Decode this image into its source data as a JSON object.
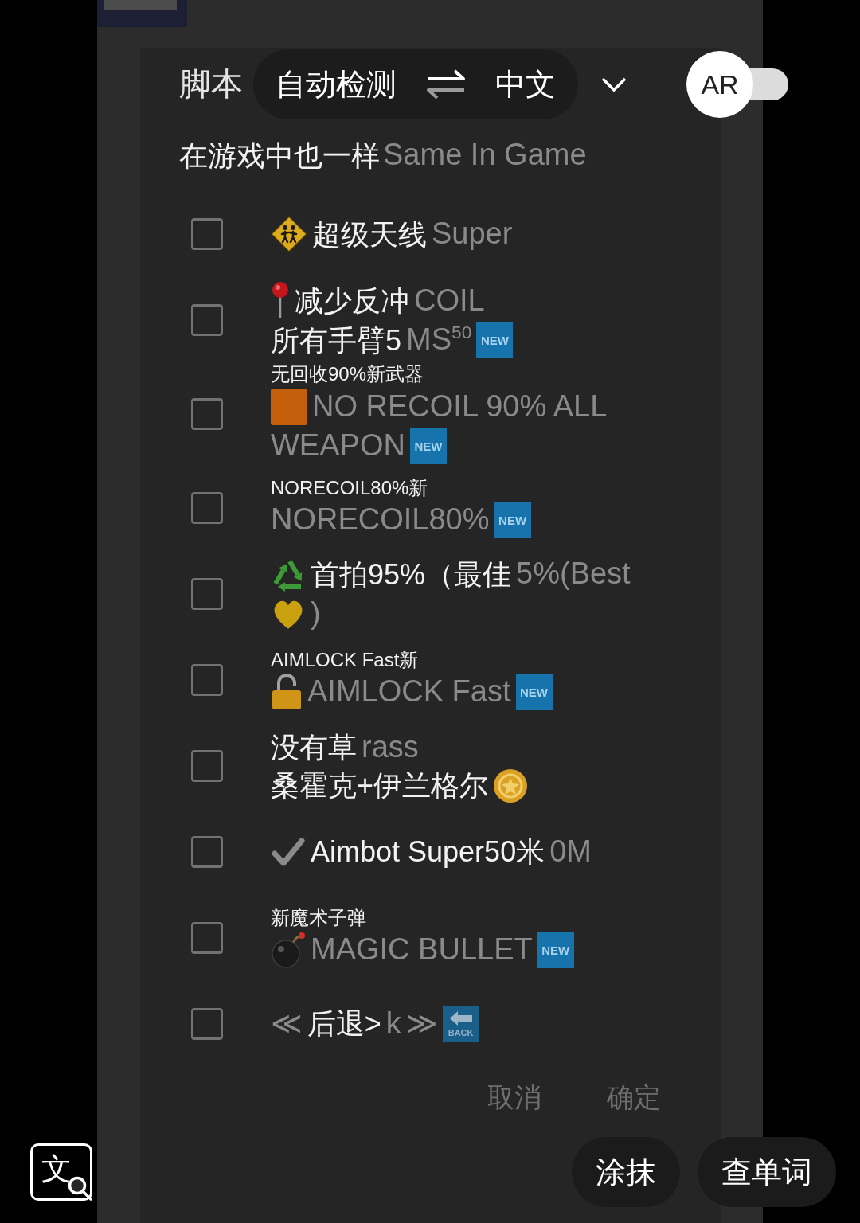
{
  "header": {
    "title": "脚本",
    "source_language": "自动检测",
    "target_language": "中文",
    "ar_switch": {
      "label": "AR",
      "on": false
    }
  },
  "subtitle": [
    {
      "kind": "translation",
      "text": "在游戏中也一样"
    },
    {
      "kind": "original",
      "text": "Same In Game"
    }
  ],
  "options": [
    {
      "checked": false,
      "lines": [
        [
          {
            "kind": "sign"
          },
          {
            "kind": "translation",
            "text": "超级天线"
          },
          {
            "kind": "original",
            "text": "Super"
          }
        ]
      ]
    },
    {
      "checked": false,
      "lines": [
        [
          {
            "kind": "pin"
          },
          {
            "kind": "translation",
            "text": "减少反冲"
          },
          {
            "kind": "original",
            "text": "COIL"
          }
        ],
        [
          {
            "kind": "translation",
            "text": "所有手臂5"
          },
          {
            "kind": "original",
            "text": "MS$^{50}$"
          },
          {
            "kind": "badge",
            "text": "NEW"
          }
        ]
      ]
    },
    {
      "checked": false,
      "lines": [
        [
          {
            "kind": "caption",
            "text": "无回收90%新武器"
          }
        ],
        [
          {
            "kind": "tile"
          },
          {
            "kind": "original",
            "text": "NO RECOIL 90% ALL"
          }
        ],
        [
          {
            "kind": "original",
            "text": "WEAPON"
          },
          {
            "kind": "badge",
            "text": "NEW"
          }
        ]
      ]
    },
    {
      "checked": false,
      "lines": [
        [
          {
            "kind": "caption",
            "text": "NORECOIL80%新"
          }
        ],
        [
          {
            "kind": "original",
            "text": "NORECOIL80%"
          },
          {
            "kind": "badge",
            "text": "NEW"
          }
        ]
      ]
    },
    {
      "checked": false,
      "lines": [
        [
          {
            "kind": "recycle"
          },
          {
            "kind": "translation",
            "text": "首拍95%（最佳"
          },
          {
            "kind": "original",
            "text": "5%(Best"
          }
        ],
        [
          {
            "kind": "heart"
          },
          {
            "kind": "original",
            "text": ")"
          }
        ]
      ]
    },
    {
      "checked": false,
      "lines": [
        [
          {
            "kind": "caption",
            "text": "AIMLOCK Fast新"
          }
        ],
        [
          {
            "kind": "padlock"
          },
          {
            "kind": "original",
            "text": "AIMLOCK Fast"
          },
          {
            "kind": "badge",
            "text": "NEW"
          }
        ]
      ]
    },
    {
      "checked": false,
      "lines": [
        [
          {
            "kind": "translation",
            "text": "没有草"
          },
          {
            "kind": "original",
            "text": "rass"
          }
        ],
        [
          {
            "kind": "translation",
            "text": "桑霍克+伊兰格尔"
          },
          {
            "kind": "coin"
          }
        ]
      ]
    },
    {
      "checked": false,
      "lines": [
        [
          {
            "kind": "check"
          },
          {
            "kind": "translation",
            "text": "Aimbot Super50米"
          },
          {
            "kind": "original",
            "text": "0M"
          }
        ]
      ]
    },
    {
      "checked": false,
      "lines": [
        [
          {
            "kind": "caption",
            "text": "新魔术子弹"
          }
        ],
        [
          {
            "kind": "bomb"
          },
          {
            "kind": "original",
            "text": "MAGIC BULLET"
          },
          {
            "kind": "badge",
            "text": "NEW"
          }
        ]
      ]
    },
    {
      "checked": false,
      "lines": [
        [
          {
            "kind": "original",
            "text": "≪"
          },
          {
            "kind": "translation",
            "text": "后退>"
          },
          {
            "kind": "original",
            "text": "k"
          },
          {
            "kind": "original",
            "text": "≫"
          },
          {
            "kind": "back",
            "text": "BACK"
          }
        ]
      ]
    }
  ],
  "dialog_buttons": [
    "取消",
    "确定"
  ],
  "tools": {
    "translate_glyph": "文",
    "buttons": [
      "涂抹",
      "查单词"
    ]
  }
}
